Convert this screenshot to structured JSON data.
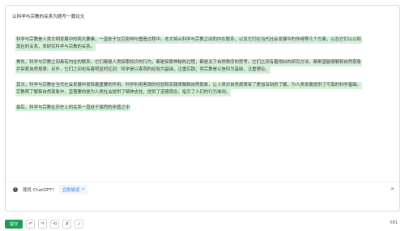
{
  "prompt": "以科学与宗教的关系为题写一篇论文",
  "paragraphs": [
    [
      "科学与宗教是人类文明发展中的两大要素，一直处于交互影响与塑造过程中。本文将从科学与宗教之间的内在联系，以及它们在当代社会发展中的作用等几个方面，以及它们以以和",
      "现在的关系，来研究科学与宗教的关系。"
    ],
    [
      "首先，科学与宗教之间具有内在的联系。它们都是人类探索知识的行为，都是探索神秘的过程，都是关于自然秩序的思考。它们之间有着相似的研究方法，都希望能够解释自然现象",
      "并探索自然规律。另外，它们之间也有着明显的区别：科学是以客观的经验为基础，注重实践；而宗教是以信仰为基础，注重理论。"
    ],
    [
      "其次，科学与宗教在当代社会发展中发挥着重要的作用。科学利用客观的经验和实践来解释自然现象，让人类对自然规律有了更加深刻的了解，为人类发展提供了可靠的科学基础。",
      "宗教帮了解释自然现象中，显著要的是为人类社会提供了精神支柱，提供了道德观念，指引了人们的行为准则。"
    ],
    [
      "最后，科学与宗教在历史上的关系一直处于激烈的矛盾之中"
    ]
  ],
  "banner": {
    "info_icon": "info-icon",
    "label": "尊找 ChatGPT?",
    "try_label": "立即尝试",
    "try_icon": "external-link-icon",
    "close_icon": "close-icon"
  },
  "toolbar": {
    "submit_label": "提交",
    "buttons": [
      {
        "name": "undo-icon",
        "glyph": "↶"
      },
      {
        "name": "redo-icon",
        "glyph": "↷"
      },
      {
        "name": "history-icon",
        "glyph": "⟲"
      },
      {
        "name": "thumbs-down-icon",
        "glyph": "✗"
      },
      {
        "name": "thumbs-up-icon",
        "glyph": "✓"
      }
    ],
    "char_count": "681"
  }
}
